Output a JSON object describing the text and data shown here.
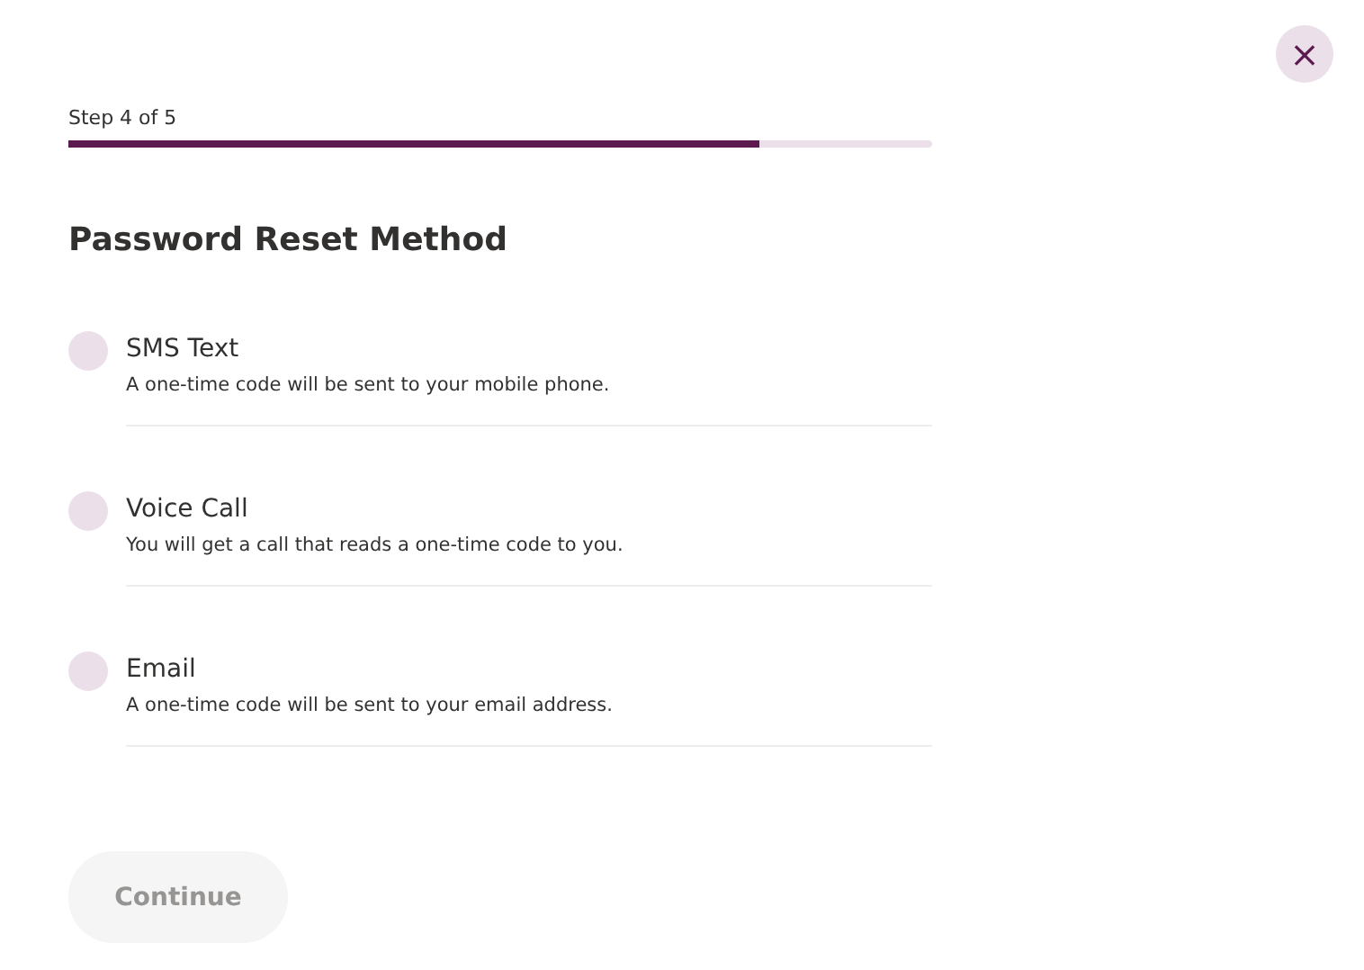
{
  "close_button": {
    "label": "×"
  },
  "progress": {
    "label": "Step 4 of 5",
    "level": 0.8
  },
  "title": "Password Reset Method",
  "options": [
    {
      "label": "SMS Text",
      "description": "A one-time code will be sent to your mobile phone.",
      "selected": false
    },
    {
      "label": "Voice Call",
      "description": "You will get a call that reads a one-time code to you.",
      "selected": false
    },
    {
      "label": "Email",
      "description": "A one-time code will be sent to your email address.",
      "selected": false
    }
  ],
  "continue_button": {
    "label": "Continue",
    "disabled": true
  }
}
